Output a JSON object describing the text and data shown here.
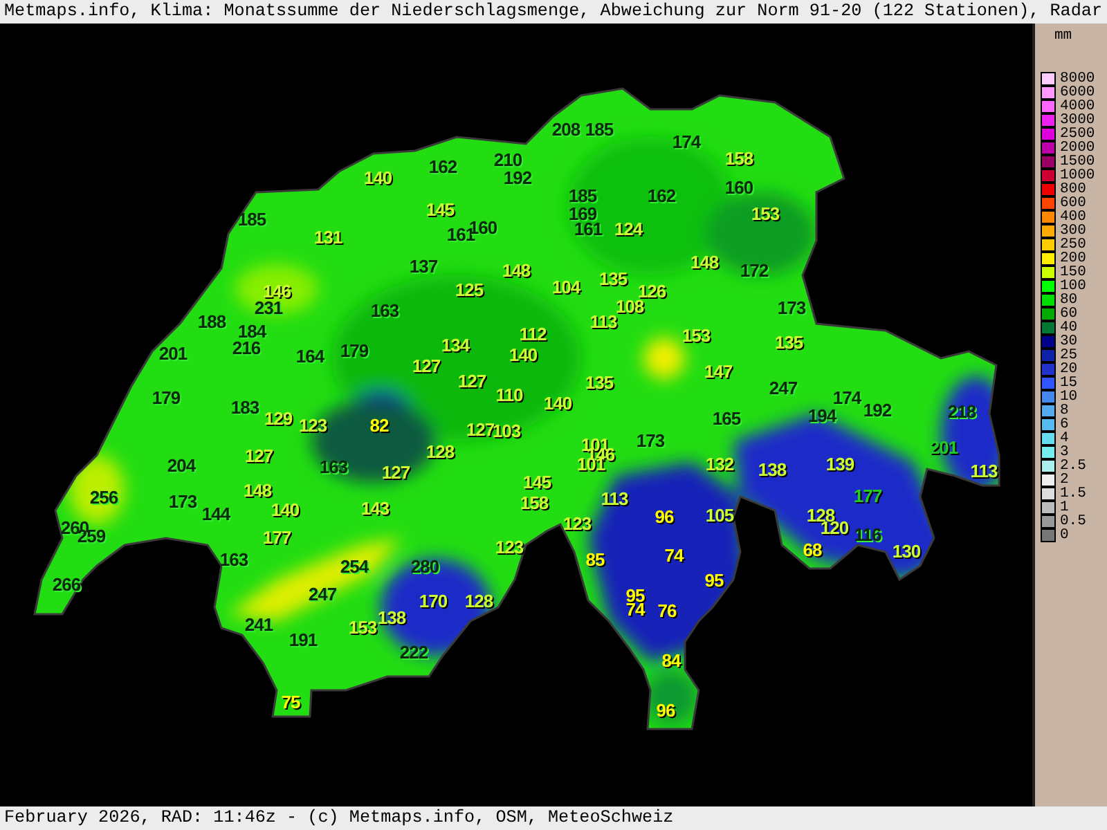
{
  "title_bar": {
    "text": "Metmaps.info, Klima: Monatssumme der Niederschlagsmenge, Abweichung zur Norm 91-20 (122 Stationen), Radar"
  },
  "legend": {
    "unit": "mm",
    "items": [
      {
        "label": "8000",
        "color": "#ffccff"
      },
      {
        "label": "6000",
        "color": "#ff99ff"
      },
      {
        "label": "4000",
        "color": "#ff66ff"
      },
      {
        "label": "3000",
        "color": "#ee22ee"
      },
      {
        "label": "2500",
        "color": "#dd00dd"
      },
      {
        "label": "2000",
        "color": "#bb00aa"
      },
      {
        "label": "1500",
        "color": "#990066"
      },
      {
        "label": "1000",
        "color": "#cc0033"
      },
      {
        "label": "800",
        "color": "#ee0000"
      },
      {
        "label": "600",
        "color": "#ff4400"
      },
      {
        "label": "400",
        "color": "#ff8800"
      },
      {
        "label": "300",
        "color": "#ffaa00"
      },
      {
        "label": "250",
        "color": "#ffcc00"
      },
      {
        "label": "200",
        "color": "#ffee00"
      },
      {
        "label": "150",
        "color": "#ccff00"
      },
      {
        "label": "100",
        "color": "#00ff00"
      },
      {
        "label": "80",
        "color": "#00dd00"
      },
      {
        "label": "60",
        "color": "#00aa00"
      },
      {
        "label": "40",
        "color": "#007733"
      },
      {
        "label": "30",
        "color": "#000088"
      },
      {
        "label": "25",
        "color": "#1122aa"
      },
      {
        "label": "20",
        "color": "#2233cc"
      },
      {
        "label": "15",
        "color": "#3355ff"
      },
      {
        "label": "10",
        "color": "#4488ee"
      },
      {
        "label": "8",
        "color": "#55aaee"
      },
      {
        "label": "6",
        "color": "#55bbee"
      },
      {
        "label": "4",
        "color": "#66ddee"
      },
      {
        "label": "3",
        "color": "#77eeee"
      },
      {
        "label": "2.5",
        "color": "#aaeeee"
      },
      {
        "label": "2",
        "color": "#eeeeee"
      },
      {
        "label": "1.5",
        "color": "#dddddd"
      },
      {
        "label": "1",
        "color": "#bbbbbb"
      },
      {
        "label": "0.5",
        "color": "#999999"
      },
      {
        "label": "0",
        "color": "#777777"
      }
    ]
  },
  "stations": [
    {
      "value": "140",
      "color": "#ccff33"
    },
    {
      "value": "162",
      "color": "#0b2a0b"
    },
    {
      "value": "210",
      "color": "#0b2a0b"
    },
    {
      "value": "192",
      "color": "#0b2a0b"
    },
    {
      "value": "208",
      "color": "#0b2a0b"
    },
    {
      "value": "185",
      "color": "#0b2a0b"
    },
    {
      "value": "174",
      "color": "#0b2a0b"
    },
    {
      "value": "158",
      "color": "#ccff33"
    },
    {
      "value": "185",
      "color": "#0b2a0b"
    },
    {
      "value": "131",
      "color": "#ccff33"
    },
    {
      "value": "145",
      "color": "#ccff33"
    },
    {
      "value": "161",
      "color": "#0b2a0b"
    },
    {
      "value": "160",
      "color": "#0b2a0b"
    },
    {
      "value": "185",
      "color": "#0b2a0b"
    },
    {
      "value": "169",
      "color": "#0b2a0b"
    },
    {
      "value": "161",
      "color": "#0b2a0b"
    },
    {
      "value": "124",
      "color": "#ccff33"
    },
    {
      "value": "162",
      "color": "#0b2a0b"
    },
    {
      "value": "160",
      "color": "#0b2a0b"
    },
    {
      "value": "153",
      "color": "#ccff33"
    },
    {
      "value": "137",
      "color": "#0b2a0b"
    },
    {
      "value": "148",
      "color": "#ccff33"
    },
    {
      "value": "125",
      "color": "#ccff33"
    },
    {
      "value": "148",
      "color": "#ccff33"
    },
    {
      "value": "172",
      "color": "#0b2a0b"
    },
    {
      "value": "146",
      "color": "#ccff33"
    },
    {
      "value": "231",
      "color": "#0b2a0b"
    },
    {
      "value": "104",
      "color": "#ccff33"
    },
    {
      "value": "135",
      "color": "#ccff33"
    },
    {
      "value": "108",
      "color": "#ccff33"
    },
    {
      "value": "126",
      "color": "#ccff33"
    },
    {
      "value": "163",
      "color": "#0b2a0b"
    },
    {
      "value": "188",
      "color": "#0b2a0b"
    },
    {
      "value": "184",
      "color": "#0b2a0b"
    },
    {
      "value": "113",
      "color": "#ccff33"
    },
    {
      "value": "173",
      "color": "#0b2a0b"
    },
    {
      "value": "153",
      "color": "#ccff33"
    },
    {
      "value": "135",
      "color": "#ccff33"
    },
    {
      "value": "112",
      "color": "#ccff33"
    },
    {
      "value": "201",
      "color": "#0b2a0b"
    },
    {
      "value": "216",
      "color": "#0b2a0b"
    },
    {
      "value": "164",
      "color": "#0b2a0b"
    },
    {
      "value": "179",
      "color": "#0b2a0b"
    },
    {
      "value": "134",
      "color": "#ccff33"
    },
    {
      "value": "127",
      "color": "#ccff33"
    },
    {
      "value": "140",
      "color": "#ccff33"
    },
    {
      "value": "147",
      "color": "#ccff33"
    },
    {
      "value": "127",
      "color": "#ccff33"
    },
    {
      "value": "110",
      "color": "#ccff33"
    },
    {
      "value": "135",
      "color": "#ccff33"
    },
    {
      "value": "247",
      "color": "#0b2a0b"
    },
    {
      "value": "179",
      "color": "#0b2a0b"
    },
    {
      "value": "183",
      "color": "#0b2a0b"
    },
    {
      "value": "129",
      "color": "#ccff33"
    },
    {
      "value": "123",
      "color": "#ccff33"
    },
    {
      "value": "82",
      "color": "#ffff00"
    },
    {
      "value": "140",
      "color": "#ccff33"
    },
    {
      "value": "165",
      "color": "#0b2a0b"
    },
    {
      "value": "194",
      "color": "#0b2a0b"
    },
    {
      "value": "174",
      "color": "#0b2a0b"
    },
    {
      "value": "192",
      "color": "#0b2a0b"
    },
    {
      "value": "218",
      "color": "#0b2a0b"
    },
    {
      "value": "127",
      "color": "#ccff33"
    },
    {
      "value": "103",
      "color": "#ccff33"
    },
    {
      "value": "101",
      "color": "#ccff33"
    },
    {
      "value": "173",
      "color": "#0b2a0b"
    },
    {
      "value": "146",
      "color": "#ccff33"
    },
    {
      "value": "101",
      "color": "#ccff33"
    },
    {
      "value": "127",
      "color": "#ccff33"
    },
    {
      "value": "128",
      "color": "#ccff33"
    },
    {
      "value": "204",
      "color": "#0b2a0b"
    },
    {
      "value": "163",
      "color": "#0b2a0b"
    },
    {
      "value": "127",
      "color": "#ccff33"
    },
    {
      "value": "132",
      "color": "#ccff33"
    },
    {
      "value": "138",
      "color": "#ccff33"
    },
    {
      "value": "139",
      "color": "#ccff33"
    },
    {
      "value": "201",
      "color": "#22cc22"
    },
    {
      "value": "113",
      "color": "#ccff33"
    },
    {
      "value": "256",
      "color": "#0b2a0b"
    },
    {
      "value": "173",
      "color": "#0b2a0b"
    },
    {
      "value": "148",
      "color": "#ccff33"
    },
    {
      "value": "145",
      "color": "#ccff33"
    },
    {
      "value": "158",
      "color": "#ccff33"
    },
    {
      "value": "113",
      "color": "#ccff33"
    },
    {
      "value": "177",
      "color": "#22cc22"
    },
    {
      "value": "144",
      "color": "#0b2a0b"
    },
    {
      "value": "140",
      "color": "#ccff33"
    },
    {
      "value": "143",
      "color": "#ccff33"
    },
    {
      "value": "96",
      "color": "#ffff00"
    },
    {
      "value": "105",
      "color": "#ccff33"
    },
    {
      "value": "123",
      "color": "#ccff33"
    },
    {
      "value": "128",
      "color": "#ccff33"
    },
    {
      "value": "120",
      "color": "#ccff33"
    },
    {
      "value": "116",
      "color": "#0b2a0b"
    },
    {
      "value": "260",
      "color": "#0b2a0b"
    },
    {
      "value": "259",
      "color": "#0b2a0b"
    },
    {
      "value": "177",
      "color": "#ccff33"
    },
    {
      "value": "68",
      "color": "#ffff00"
    },
    {
      "value": "130",
      "color": "#ccff33"
    },
    {
      "value": "85",
      "color": "#ffff00"
    },
    {
      "value": "74",
      "color": "#ffff00"
    },
    {
      "value": "254",
      "color": "#0b2a0b"
    },
    {
      "value": "280",
      "color": "#0b2a0b"
    },
    {
      "value": "123",
      "color": "#ccff33"
    },
    {
      "value": "95",
      "color": "#ffff00"
    },
    {
      "value": "163",
      "color": "#0b2a0b"
    },
    {
      "value": "266",
      "color": "#0b2a0b"
    },
    {
      "value": "247",
      "color": "#0b2a0b"
    },
    {
      "value": "138",
      "color": "#ccff33"
    },
    {
      "value": "170",
      "color": "#ccff33"
    },
    {
      "value": "128",
      "color": "#ccff33"
    },
    {
      "value": "95",
      "color": "#ffff00"
    },
    {
      "value": "74",
      "color": "#ffff00"
    },
    {
      "value": "76",
      "color": "#ffff00"
    },
    {
      "value": "241",
      "color": "#0b2a0b"
    },
    {
      "value": "153",
      "color": "#ccff33"
    },
    {
      "value": "191",
      "color": "#0b2a0b"
    },
    {
      "value": "222",
      "color": "#0b2a0b"
    },
    {
      "value": "84",
      "color": "#ffff00"
    },
    {
      "value": "75",
      "color": "#ffff00"
    },
    {
      "value": "96",
      "color": "#ffff00"
    }
  ],
  "status_bar": {
    "text": "February 2026, RAD: 11:46z - (c) Metmaps.info, OSM, MeteoSchweiz"
  }
}
